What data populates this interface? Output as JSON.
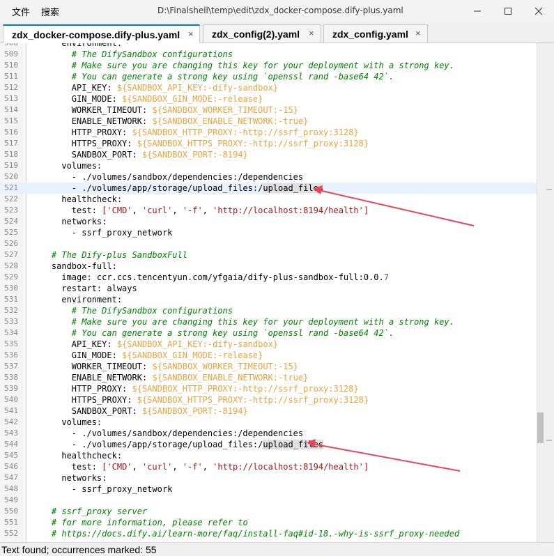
{
  "menu": {
    "file": "文件",
    "search": "搜索"
  },
  "window": {
    "title": "D:\\Finalshell\\temp\\edit\\zdx_docker-compose.dify-plus.yaml"
  },
  "tabs": [
    {
      "label": "zdx_docker-compose.dify-plus.yaml",
      "close": "×",
      "active": true
    },
    {
      "label": "zdx_config(2).yaml",
      "close": "×",
      "active": false
    },
    {
      "label": "zdx_config.yaml",
      "close": "×",
      "active": false
    }
  ],
  "editor": {
    "current_line": 521,
    "lines": [
      {
        "n": "508",
        "tokens": [
          {
            "t": "      environment:",
            "c": "t-punct"
          }
        ]
      },
      {
        "n": "509",
        "tokens": [
          {
            "t": "        ",
            "c": ""
          },
          {
            "t": "# The DifySandbox configurations",
            "c": "t-comment"
          }
        ]
      },
      {
        "n": "510",
        "tokens": [
          {
            "t": "        ",
            "c": ""
          },
          {
            "t": "# Make sure you are changing this key for your deployment with a strong key.",
            "c": "t-comment"
          }
        ]
      },
      {
        "n": "511",
        "tokens": [
          {
            "t": "        ",
            "c": ""
          },
          {
            "t": "# You can generate a strong key using `openssl rand -base64 42`.",
            "c": "t-comment"
          }
        ]
      },
      {
        "n": "512",
        "tokens": [
          {
            "t": "        API_KEY: ",
            "c": ""
          },
          {
            "t": "${SANDBOX_API_KEY:-dify-sandbox}",
            "c": "t-var"
          }
        ]
      },
      {
        "n": "513",
        "tokens": [
          {
            "t": "        GIN_MODE: ",
            "c": ""
          },
          {
            "t": "${SANDBOX_GIN_MODE:-release}",
            "c": "t-var"
          }
        ]
      },
      {
        "n": "514",
        "tokens": [
          {
            "t": "        WORKER_TIMEOUT: ",
            "c": ""
          },
          {
            "t": "${SANDBOX_WORKER_TIMEOUT:-15}",
            "c": "t-var"
          }
        ]
      },
      {
        "n": "515",
        "tokens": [
          {
            "t": "        ENABLE_NETWORK: ",
            "c": ""
          },
          {
            "t": "${SANDBOX_ENABLE_NETWORK:-true}",
            "c": "t-var"
          }
        ]
      },
      {
        "n": "516",
        "tokens": [
          {
            "t": "        HTTP_PROXY: ",
            "c": ""
          },
          {
            "t": "${SANDBOX_HTTP_PROXY:-http://ssrf_proxy:3128}",
            "c": "t-var"
          }
        ]
      },
      {
        "n": "517",
        "tokens": [
          {
            "t": "        HTTPS_PROXY: ",
            "c": ""
          },
          {
            "t": "${SANDBOX_HTTPS_PROXY:-http://ssrf_proxy:3128}",
            "c": "t-var"
          }
        ]
      },
      {
        "n": "518",
        "tokens": [
          {
            "t": "        SANDBOX_PORT: ",
            "c": ""
          },
          {
            "t": "${SANDBOX_PORT:-8194}",
            "c": "t-var"
          }
        ]
      },
      {
        "n": "519",
        "tokens": [
          {
            "t": "      volumes:",
            "c": ""
          }
        ]
      },
      {
        "n": "520",
        "tokens": [
          {
            "t": "        - ./volumes/sandbox/dependencies:/dependencies",
            "c": ""
          }
        ]
      },
      {
        "n": "521",
        "tokens": [
          {
            "t": "        - ./volumes/app/storage/upload_files:/",
            "c": ""
          },
          {
            "t": "upload_files",
            "c": "t-found"
          }
        ]
      },
      {
        "n": "522",
        "tokens": [
          {
            "t": "      healthcheck:",
            "c": ""
          }
        ]
      },
      {
        "n": "523",
        "tokens": [
          {
            "t": "        test: ",
            "c": ""
          },
          {
            "t": "[",
            "c": "t-br"
          },
          {
            "t": "'CMD'",
            "c": "t-str"
          },
          {
            "t": ", ",
            "c": ""
          },
          {
            "t": "'curl'",
            "c": "t-str"
          },
          {
            "t": ", ",
            "c": ""
          },
          {
            "t": "'-f'",
            "c": "t-str"
          },
          {
            "t": ", ",
            "c": ""
          },
          {
            "t": "'http://localhost:8194/health'",
            "c": "t-str"
          },
          {
            "t": "]",
            "c": "t-br"
          }
        ]
      },
      {
        "n": "524",
        "tokens": [
          {
            "t": "      networks:",
            "c": ""
          }
        ]
      },
      {
        "n": "525",
        "tokens": [
          {
            "t": "        - ssrf_proxy_network",
            "c": ""
          }
        ]
      },
      {
        "n": "526",
        "tokens": [
          {
            "t": "",
            "c": ""
          }
        ]
      },
      {
        "n": "527",
        "tokens": [
          {
            "t": "    ",
            "c": ""
          },
          {
            "t": "# The Dify-plus SandboxFull",
            "c": "t-comment"
          }
        ]
      },
      {
        "n": "528",
        "tokens": [
          {
            "t": "    sandbox-full:",
            "c": ""
          }
        ]
      },
      {
        "n": "529",
        "tokens": [
          {
            "t": "      image: ccr.ccs.tencentyun.com/yfgaia/dify-plus-sandbox-full:0.0.",
            "c": ""
          },
          {
            "t": "7",
            "c": "t-num"
          }
        ]
      },
      {
        "n": "530",
        "tokens": [
          {
            "t": "      restart: always",
            "c": ""
          }
        ]
      },
      {
        "n": "531",
        "tokens": [
          {
            "t": "      environment:",
            "c": ""
          }
        ]
      },
      {
        "n": "532",
        "tokens": [
          {
            "t": "        ",
            "c": ""
          },
          {
            "t": "# The DifySandbox configurations",
            "c": "t-comment"
          }
        ]
      },
      {
        "n": "533",
        "tokens": [
          {
            "t": "        ",
            "c": ""
          },
          {
            "t": "# Make sure you are changing this key for your deployment with a strong key.",
            "c": "t-comment"
          }
        ]
      },
      {
        "n": "534",
        "tokens": [
          {
            "t": "        ",
            "c": ""
          },
          {
            "t": "# You can generate a strong key using `openssl rand -base64 42`.",
            "c": "t-comment"
          }
        ]
      },
      {
        "n": "535",
        "tokens": [
          {
            "t": "        API_KEY: ",
            "c": ""
          },
          {
            "t": "${SANDBOX_API_KEY:-dify-sandbox}",
            "c": "t-var"
          }
        ]
      },
      {
        "n": "536",
        "tokens": [
          {
            "t": "        GIN_MODE: ",
            "c": ""
          },
          {
            "t": "${SANDBOX_GIN_MODE:-release}",
            "c": "t-var"
          }
        ]
      },
      {
        "n": "537",
        "tokens": [
          {
            "t": "        WORKER_TIMEOUT: ",
            "c": ""
          },
          {
            "t": "${SANDBOX_WORKER_TIMEOUT:-15}",
            "c": "t-var"
          }
        ]
      },
      {
        "n": "538",
        "tokens": [
          {
            "t": "        ENABLE_NETWORK: ",
            "c": ""
          },
          {
            "t": "${SANDBOX_ENABLE_NETWORK:-true}",
            "c": "t-var"
          }
        ]
      },
      {
        "n": "539",
        "tokens": [
          {
            "t": "        HTTP_PROXY: ",
            "c": ""
          },
          {
            "t": "${SANDBOX_HTTP_PROXY:-http://ssrf_proxy:3128}",
            "c": "t-var"
          }
        ]
      },
      {
        "n": "540",
        "tokens": [
          {
            "t": "        HTTPS_PROXY: ",
            "c": ""
          },
          {
            "t": "${SANDBOX_HTTPS_PROXY:-http://ssrf_proxy:3128}",
            "c": "t-var"
          }
        ]
      },
      {
        "n": "541",
        "tokens": [
          {
            "t": "        SANDBOX_PORT: ",
            "c": ""
          },
          {
            "t": "${SANDBOX_PORT:-8194}",
            "c": "t-var"
          }
        ]
      },
      {
        "n": "542",
        "tokens": [
          {
            "t": "      volumes:",
            "c": ""
          }
        ]
      },
      {
        "n": "543",
        "tokens": [
          {
            "t": "        - ./volumes/sandbox/dependencies:/dependencies",
            "c": ""
          }
        ]
      },
      {
        "n": "544",
        "tokens": [
          {
            "t": "        - ./volumes/app/storage/upload_files:/",
            "c": ""
          },
          {
            "t": "upload_files",
            "c": "t-found"
          }
        ]
      },
      {
        "n": "545",
        "tokens": [
          {
            "t": "      healthcheck:",
            "c": ""
          }
        ]
      },
      {
        "n": "546",
        "tokens": [
          {
            "t": "        test: ",
            "c": ""
          },
          {
            "t": "[",
            "c": "t-br"
          },
          {
            "t": "'CMD'",
            "c": "t-str"
          },
          {
            "t": ", ",
            "c": ""
          },
          {
            "t": "'curl'",
            "c": "t-str"
          },
          {
            "t": ", ",
            "c": ""
          },
          {
            "t": "'-f'",
            "c": "t-str"
          },
          {
            "t": ", ",
            "c": ""
          },
          {
            "t": "'http://localhost:8194/health'",
            "c": "t-str"
          },
          {
            "t": "]",
            "c": "t-br"
          }
        ]
      },
      {
        "n": "547",
        "tokens": [
          {
            "t": "      networks:",
            "c": ""
          }
        ]
      },
      {
        "n": "548",
        "tokens": [
          {
            "t": "        - ssrf_proxy_network",
            "c": ""
          }
        ]
      },
      {
        "n": "549",
        "tokens": [
          {
            "t": "",
            "c": ""
          }
        ]
      },
      {
        "n": "550",
        "tokens": [
          {
            "t": "    ",
            "c": ""
          },
          {
            "t": "# ssrf_proxy server",
            "c": "t-comment"
          }
        ]
      },
      {
        "n": "551",
        "tokens": [
          {
            "t": "    ",
            "c": ""
          },
          {
            "t": "# for more information, please refer to",
            "c": "t-comment"
          }
        ]
      },
      {
        "n": "552",
        "tokens": [
          {
            "t": "    ",
            "c": ""
          },
          {
            "t": "# https://docs.dify.ai/learn-more/faq/install-faq#id-18.-why-is-ssrf_proxy-needed",
            "c": "t-comment"
          }
        ]
      }
    ]
  },
  "status": {
    "text": "Text found; occurrences marked: 55"
  },
  "colors": {
    "accent": "#0078d7",
    "arrow": "#e8445a",
    "comment": "#008000",
    "variable": "#e8a33d",
    "string": "#a31515"
  }
}
